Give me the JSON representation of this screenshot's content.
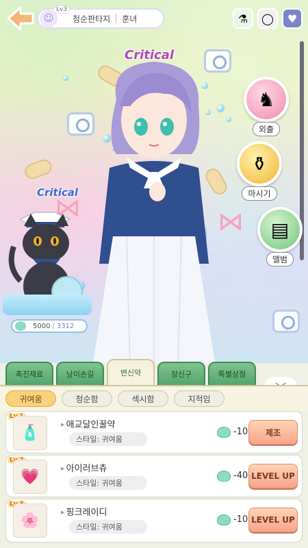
{
  "header": {
    "level": "Lv3",
    "name": "청순판타지",
    "tag": "훈녀"
  },
  "top_icons": [
    "potion-shop-icon",
    "mirror-icon",
    "wings-icon"
  ],
  "effects": {
    "critical_top": "Critical",
    "critical_cat": "Critical"
  },
  "side_menu": [
    {
      "label": "외출",
      "icon": "rocking-horse-icon",
      "color": "#f39bb6"
    },
    {
      "label": "마시기",
      "icon": "flask-icon",
      "color": "#f7c54e"
    },
    {
      "label": "앨범",
      "icon": "album-icon",
      "color": "#7fd08e"
    }
  ],
  "pet": {
    "stat_current": "5000",
    "stat_sep": "/",
    "stat_max": "3312"
  },
  "tabs": [
    {
      "label": "촉진재료",
      "active": false
    },
    {
      "label": "낭이손길",
      "active": false
    },
    {
      "label": "변신약",
      "active": true
    },
    {
      "label": "장신구",
      "active": false
    },
    {
      "label": "특별상점",
      "active": false
    }
  ],
  "collapse_icon": "chevron-down-icon",
  "filters": [
    {
      "label": "귀여움",
      "active": true
    },
    {
      "label": "청순함",
      "active": false
    },
    {
      "label": "섹시함",
      "active": false
    },
    {
      "label": "지적임",
      "active": false
    }
  ],
  "items": [
    {
      "level": "Lv.1",
      "name": "애교달인꿀약",
      "style": "스타일: 귀여움",
      "cost": "-10",
      "action": "제조",
      "icon": "potion-bottle-icon"
    },
    {
      "level": "Lv.2",
      "name": "아이러브츄",
      "style": "스타일: 귀여움",
      "cost": "-40",
      "action": "LEVEL UP",
      "icon": "heart-potion-icon"
    },
    {
      "level": "Lv.3",
      "name": "핑크레이디",
      "style": "스타일: 귀여움",
      "cost": "-10",
      "action": "LEVEL UP",
      "icon": "pink-potion-icon"
    }
  ]
}
